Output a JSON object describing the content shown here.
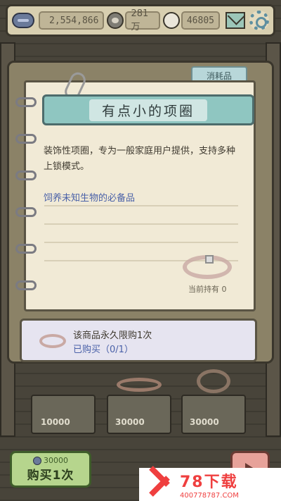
{
  "top_bar": {
    "coins": "2,554,866",
    "gems": "281万",
    "speech_count": "46805",
    "icons": [
      "coin-icon",
      "bubble-icon",
      "speech-icon",
      "mail-icon",
      "gear-icon"
    ]
  },
  "category_tab": {
    "label": "消耗品"
  },
  "item": {
    "title": "有点小的项圈",
    "description": "装饰性项圈，专为一般家庭用户提供，支持多种上锁模式。",
    "flavor": "饲养未知生物的必备品",
    "owned_label": "当前持有 0"
  },
  "purchase_panel": {
    "limit": "该商品永久限购1次",
    "bought": "已购买（0/1）"
  },
  "shelf": {
    "prices": [
      "10000",
      "30000",
      "30000"
    ]
  },
  "buy_button": {
    "cost": "30000",
    "label": "购买1次"
  },
  "watermark": {
    "title": "78下载",
    "url": "400778787.COM"
  },
  "colors": {
    "title_banner": "#8fc6c1",
    "buy_button": "#b6d58d",
    "flavor_text": "#4a61a8",
    "watermark": "#ef3f3f"
  }
}
